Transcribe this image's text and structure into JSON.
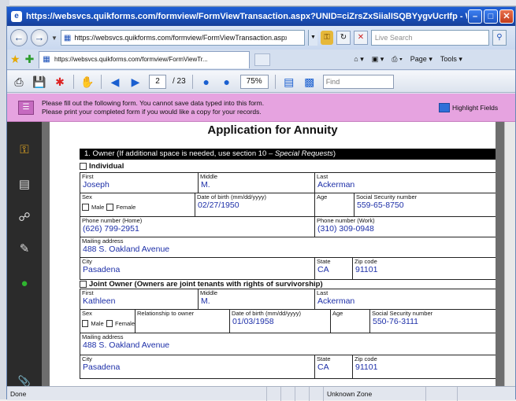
{
  "browser": {
    "title": "https://websvcs.quikforms.com/formview/FormViewTransaction.aspx?UNID=ciZrsZxSiialISQBYygvUcrIfp - Wi...",
    "url": "https://websvcs.quikforms.com/formview/FormViewTransaction.aspx",
    "search_placeholder": "Live Search",
    "tab_label": "https://websvcs.quikforms.com/formview/FormViewTr...",
    "tools": {
      "page": "Page",
      "tools": "Tools"
    },
    "status_left": "Done",
    "status_zone": "Unknown Zone"
  },
  "pdf_toolbar": {
    "current_page": "2",
    "total_pages": "/ 23",
    "zoom": "75%",
    "find_placeholder": "Find"
  },
  "notice": {
    "line1": "Please fill out the following form. You cannot save data typed into this form.",
    "line2": "Please print your completed form if you would like a copy for your records.",
    "highlight_label": "Highlight Fields"
  },
  "form": {
    "title": "Application for Annuity",
    "section1_header": "1. Owner (If additional space is needed, use section 10 – ",
    "section1_header_italic": "Special Requests",
    "section1_header_end": ")",
    "individual_label": "Individual",
    "owner": {
      "first_label": "First",
      "first": "Joseph",
      "middle_label": "Middle",
      "middle": "M.",
      "last_label": "Last",
      "last": "Ackerman",
      "sex_label": "Sex",
      "male": "Male",
      "female": "Female",
      "dob_label": "Date of birth (mm/dd/yyyy)",
      "dob": "02/27/1950",
      "age_label": "Age",
      "ssn_label": "Social Security number",
      "ssn": "559-65-8750",
      "phone_home_label": "Phone number (Home)",
      "phone_home": "(626) 799-2951",
      "phone_work_label": "Phone number (Work)",
      "phone_work": "(310) 309-0948",
      "address_label": "Mailing address",
      "address": "488 S. Oakland Avenue",
      "city_label": "City",
      "city": "Pasadena",
      "state_label": "State",
      "state": "CA",
      "zip_label": "Zip code",
      "zip": "91101"
    },
    "joint_label": "Joint Owner (Owners are joint tenants with rights of survivorship)",
    "joint": {
      "first_label": "First",
      "first": "Kathleen",
      "middle_label": "Middle",
      "middle": "M.",
      "last_label": "Last",
      "last": "Ackerman",
      "sex_label": "Sex",
      "male": "Male",
      "female": "Female",
      "rel_label": "Relationship to owner",
      "dob_label": "Date of birth (mm/dd/yyyy)",
      "dob": "01/03/1958",
      "age_label": "Age",
      "ssn_label": "Social Security number",
      "ssn": "550-76-3111",
      "address_label": "Mailing address",
      "address": "488 S. Oakland Avenue",
      "city_label": "City",
      "city": "Pasadena",
      "state_label": "State",
      "state": "CA",
      "zip_label": "Zip code",
      "zip": "91101"
    }
  }
}
